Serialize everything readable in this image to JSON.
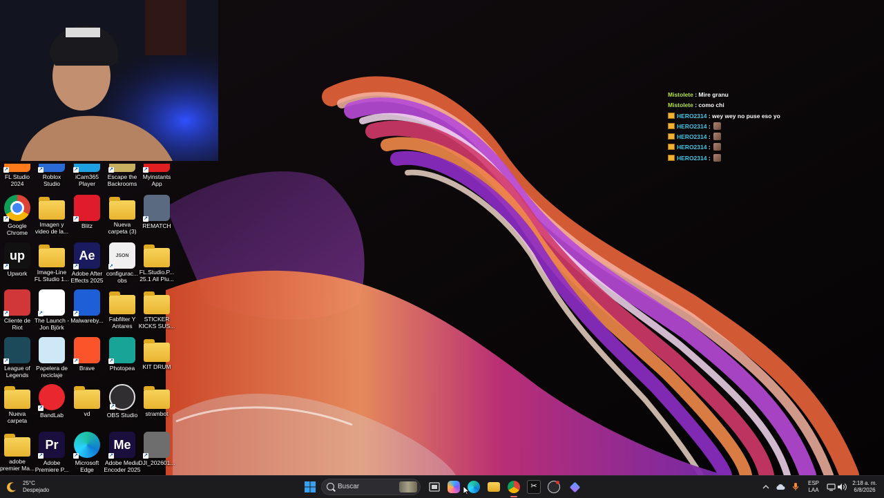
{
  "desktop_icons": [
    {
      "col": 0,
      "row": 0,
      "label": [
        "FL Studio",
        "2024"
      ],
      "icon": "fl-studio-icon",
      "color": "#ff7a1a",
      "partial": true
    },
    {
      "col": 1,
      "row": 0,
      "label": [
        "Roblox",
        "Studio"
      ],
      "icon": "roblox-studio-icon",
      "color": "#2b6bd6",
      "partial": true
    },
    {
      "col": 2,
      "row": 0,
      "label": [
        "iCam365",
        "Player"
      ],
      "icon": "icam365-icon",
      "color": "#1fa0e0",
      "partial": true
    },
    {
      "col": 3,
      "row": 0,
      "label": [
        "Escape the",
        "Backrooms"
      ],
      "icon": "escape-backrooms-icon",
      "color": "#c8b060",
      "partial": true
    },
    {
      "col": 4,
      "row": 0,
      "label": [
        "Myinstants",
        "App"
      ],
      "icon": "myinstants-icon",
      "color": "#e02020",
      "partial": true
    },
    {
      "col": 0,
      "row": 1,
      "label": [
        "Google",
        "Chrome"
      ],
      "icon": "chrome-icon",
      "color": "#4285f4"
    },
    {
      "col": 1,
      "row": 1,
      "label": [
        "Imagen y",
        "video de la..."
      ],
      "icon": "folder-icon",
      "color": "#f2c94c",
      "folder": true
    },
    {
      "col": 2,
      "row": 1,
      "label": [
        "Blitz"
      ],
      "icon": "blitz-icon",
      "color": "#e01b2c"
    },
    {
      "col": 3,
      "row": 1,
      "label": [
        "Nueva",
        "carpeta (3)"
      ],
      "icon": "folder-icon",
      "color": "#f2c94c",
      "folder": true
    },
    {
      "col": 4,
      "row": 1,
      "label": [
        "REMATCH"
      ],
      "icon": "rematch-icon",
      "color": "#5a6a80"
    },
    {
      "col": 0,
      "row": 2,
      "label": [
        "Upwork"
      ],
      "icon": "upwork-icon",
      "color": "#111111",
      "text": "up"
    },
    {
      "col": 1,
      "row": 2,
      "label": [
        "Image-Line",
        "FL Studio 1..."
      ],
      "icon": "folder-icon",
      "color": "#f2c94c",
      "folder": true
    },
    {
      "col": 2,
      "row": 2,
      "label": [
        "Adobe After",
        "Effects 2025"
      ],
      "icon": "after-effects-icon",
      "color": "#1a1a5e",
      "text": "Ae"
    },
    {
      "col": 3,
      "row": 2,
      "label": [
        "configurac...",
        "obs"
      ],
      "icon": "json-file-icon",
      "color": "#f0f0f0",
      "text": "JSON"
    },
    {
      "col": 4,
      "row": 2,
      "label": [
        "FL.Studio.P...",
        "25.1 All Plu..."
      ],
      "icon": "folder-icon",
      "color": "#f2c94c",
      "folder": true
    },
    {
      "col": 0,
      "row": 3,
      "label": [
        "Cliente de",
        "Riot"
      ],
      "icon": "riot-client-icon",
      "color": "#d13639"
    },
    {
      "col": 1,
      "row": 3,
      "label": [
        "The Launch -",
        "Jon Björk"
      ],
      "icon": "video-file-icon",
      "color": "#ffffff"
    },
    {
      "col": 2,
      "row": 3,
      "label": [
        "Malwareby..."
      ],
      "icon": "malwarebytes-icon",
      "color": "#1e5fd8"
    },
    {
      "col": 3,
      "row": 3,
      "label": [
        "Fabfilter Y",
        "Antares"
      ],
      "icon": "folder-icon",
      "color": "#f2c94c",
      "folder": true
    },
    {
      "col": 4,
      "row": 3,
      "label": [
        "STICKER",
        "KICKS SUS..."
      ],
      "icon": "folder-icon",
      "color": "#f2c94c",
      "folder": true
    },
    {
      "col": 0,
      "row": 4,
      "label": [
        "League of",
        "Legends"
      ],
      "icon": "league-of-legends-icon",
      "color": "#1d4a5a"
    },
    {
      "col": 1,
      "row": 4,
      "label": [
        "Papelera de",
        "reciclaje"
      ],
      "icon": "recycle-bin-icon",
      "color": "#cfe8f7"
    },
    {
      "col": 2,
      "row": 4,
      "label": [
        "Brave"
      ],
      "icon": "brave-icon",
      "color": "#fb542b"
    },
    {
      "col": 3,
      "row": 4,
      "label": [
        "Photopea"
      ],
      "icon": "photopea-icon",
      "color": "#18a497"
    },
    {
      "col": 4,
      "row": 4,
      "label": [
        "KIT DRUM"
      ],
      "icon": "folder-icon",
      "color": "#f2c94c",
      "folder": true
    },
    {
      "col": 0,
      "row": 5,
      "label": [
        "Nueva",
        "carpeta"
      ],
      "icon": "folder-icon",
      "color": "#f2c94c",
      "folder": true
    },
    {
      "col": 1,
      "row": 5,
      "label": [
        "BandLab"
      ],
      "icon": "bandlab-icon",
      "color": "#e8282e"
    },
    {
      "col": 2,
      "row": 5,
      "label": [
        "vd"
      ],
      "icon": "folder-icon",
      "color": "#f2c94c",
      "folder": true
    },
    {
      "col": 3,
      "row": 5,
      "label": [
        "OBS Studio"
      ],
      "icon": "obs-studio-icon",
      "color": "#302e31"
    },
    {
      "col": 4,
      "row": 5,
      "label": [
        "strambot"
      ],
      "icon": "folder-icon",
      "color": "#f2c94c",
      "folder": true
    },
    {
      "col": 0,
      "row": 6,
      "label": [
        "adobe",
        "premier Ma..."
      ],
      "icon": "folder-icon",
      "color": "#f2c94c",
      "folder": true
    },
    {
      "col": 1,
      "row": 6,
      "label": [
        "Adobe",
        "Premiere P..."
      ],
      "icon": "premiere-pro-icon",
      "color": "#1a0f3c",
      "text": "Pr"
    },
    {
      "col": 2,
      "row": 6,
      "label": [
        "Microsoft",
        "Edge"
      ],
      "icon": "edge-icon",
      "color": "#0f7bd6"
    },
    {
      "col": 3,
      "row": 6,
      "label": [
        "Adobe Media",
        "Encoder 2025"
      ],
      "icon": "media-encoder-icon",
      "color": "#1a0f3c",
      "text": "Me"
    },
    {
      "col": 4,
      "row": 6,
      "label": [
        "DJI_202601..."
      ],
      "icon": "video-file-icon",
      "color": "#6e6e6e"
    }
  ],
  "chat": [
    {
      "user": "Mistolete",
      "user_color": "#b7e63a",
      "text": "Mire granu",
      "badge": false,
      "emote": false
    },
    {
      "user": "Mistolete",
      "user_color": "#b7e63a",
      "text": "como chi",
      "badge": false,
      "emote": false
    },
    {
      "user": "HERO2314",
      "user_color": "#3fc8e8",
      "text": "wey wey no puse eso yo",
      "badge": true,
      "emote": false
    },
    {
      "user": "HERO2314",
      "user_color": "#3fc8e8",
      "text": "",
      "badge": true,
      "emote": true
    },
    {
      "user": "HERO2314",
      "user_color": "#3fc8e8",
      "text": "",
      "badge": true,
      "emote": true
    },
    {
      "user": "HERO2314",
      "user_color": "#3fc8e8",
      "text": "",
      "badge": true,
      "emote": true
    },
    {
      "user": "HERO2314",
      "user_color": "#3fc8e8",
      "text": "",
      "badge": true,
      "emote": true
    }
  ],
  "taskbar": {
    "weather_temp": "25°C",
    "weather_desc": "Despejado",
    "search_placeholder": "Buscar",
    "lang_line1": "ESP",
    "lang_line2": "LAA",
    "time": "2:18 a. m.",
    "date": "6/8/2026"
  }
}
